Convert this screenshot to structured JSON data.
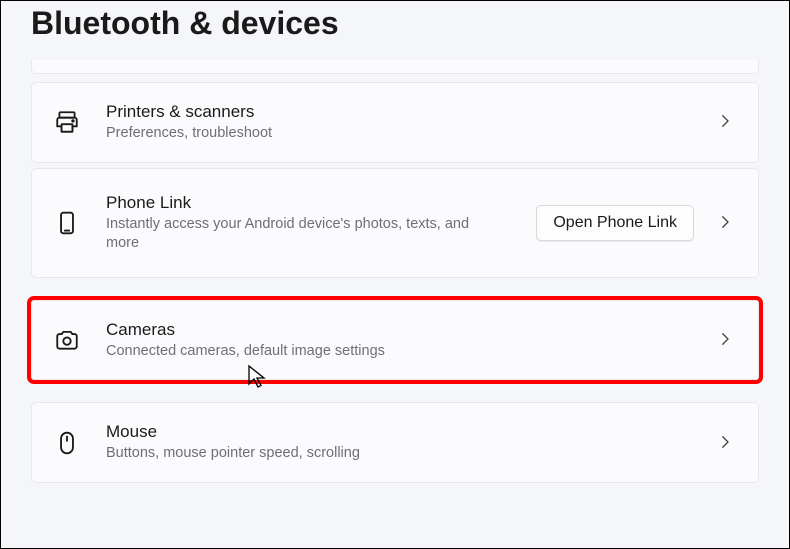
{
  "page": {
    "title": "Bluetooth & devices"
  },
  "rows": {
    "printers": {
      "title": "Printers & scanners",
      "subtitle": "Preferences, troubleshoot"
    },
    "phoneLink": {
      "title": "Phone Link",
      "subtitle": "Instantly access your Android device's photos, texts, and more",
      "buttonLabel": "Open Phone Link"
    },
    "cameras": {
      "title": "Cameras",
      "subtitle": "Connected cameras, default image settings"
    },
    "mouse": {
      "title": "Mouse",
      "subtitle": "Buttons, mouse pointer speed, scrolling"
    }
  }
}
